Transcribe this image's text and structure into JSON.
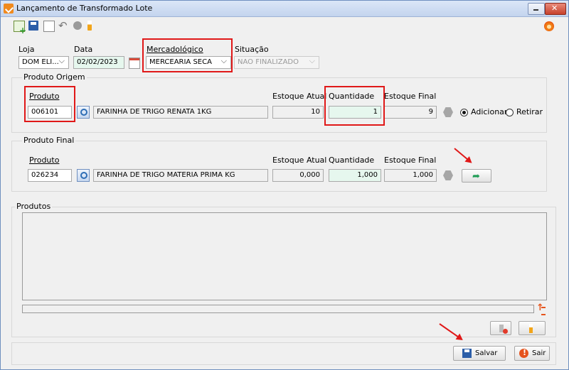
{
  "window": {
    "title": "Lançamento de Transformado Lote"
  },
  "header": {
    "loja_label": "Loja",
    "loja_value": "DOM ELI...",
    "data_label": "Data",
    "data_value": "02/02/2023",
    "mercadologico_label": "Mercadológico",
    "mercadologico_value": "MERCEARIA SECA",
    "situacao_label": "Situação",
    "situacao_value": "NAO FINALIZADO"
  },
  "origem": {
    "title": "Produto Origem",
    "produto_label": "Produto",
    "produto_code": "006101",
    "produto_desc": "FARINHA DE TRIGO RENATA 1KG",
    "estoque_atual_label": "Estoque Atual",
    "estoque_atual": "10",
    "quantidade_label": "Quantidade",
    "quantidade": "1",
    "estoque_final_label": "Estoque Final",
    "estoque_final": "9",
    "adicionar_label": "Adicionar",
    "retirar_label": "Retirar"
  },
  "final": {
    "title": "Produto Final",
    "produto_label": "Produto",
    "produto_code": "026234",
    "produto_desc": "FARINHA DE TRIGO MATERIA PRIMA KG",
    "estoque_atual_label": "Estoque Atual",
    "estoque_atual": "0,000",
    "quantidade_label": "Quantidade",
    "quantidade": "1,000",
    "estoque_final_label": "Estoque Final",
    "estoque_final": "1,000"
  },
  "produtos": {
    "title": "Produtos"
  },
  "footer": {
    "salvar_label": "Salvar",
    "sair_label": "Sair"
  },
  "colors": {
    "highlight": "#e01818",
    "accent": "#f07a14"
  }
}
